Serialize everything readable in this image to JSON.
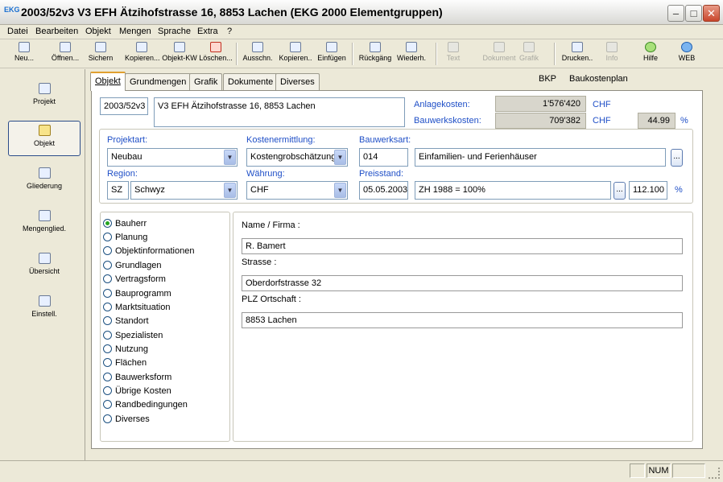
{
  "window": {
    "title": "2003/52v3 V3 EFH Ätzihofstrasse 16, 8853 Lachen (EKG 2000 Elementgruppen)",
    "icon_text": "EKG",
    "min": "‒",
    "max": "□",
    "close": "✕"
  },
  "menu": [
    "Datei",
    "Bearbeiten",
    "Objekt",
    "Mengen",
    "Sprache",
    "Extra",
    "?"
  ],
  "toolbar": {
    "neu": "Neu...",
    "oeffnen": "Öffnen...",
    "sichern": "Sichern",
    "kopieren1": "Kopieren...",
    "objekt_kw": "Objekt-KW",
    "loeschen": "Löschen...",
    "ausschn": "Ausschn.",
    "kopieren2": "Kopieren..",
    "einfuegen": "Einfügen",
    "rueckgaeng": "Rückgäng",
    "wiederh": "Wiederh.",
    "text": "Text",
    "dokument": "Dokument",
    "grafik": "Grafik",
    "drucken": "Drucken..",
    "info": "Info",
    "hilfe": "Hilfe",
    "web": "WEB"
  },
  "sidebar": [
    "Projekt",
    "Objekt",
    "Gliederung",
    "Mengenglied.",
    "Übersicht",
    "Einstell."
  ],
  "tabs": {
    "objekt": "Objekt",
    "grundmengen": "Grundmengen",
    "grafik": "Grafik",
    "dokumente": "Dokumente",
    "diverses": "Diverses"
  },
  "header": {
    "bkp": "BKP",
    "bkp_desc": "Baukostenplan"
  },
  "object": {
    "nr": "2003/52v3",
    "name": "V3 EFH Ätzihofstrasse 16, 8853 Lachen"
  },
  "costs": {
    "anlage_label": "Anlagekosten:",
    "anlage_value": "1'576'420",
    "anlage_cur": "CHF",
    "bauwerk_label": "Bauwerkskosten:",
    "bauwerk_value": "709'382",
    "bauwerk_cur": "CHF",
    "percent_value": "44.99",
    "percent_sign": "%"
  },
  "form": {
    "projektart_label": "Projektart:",
    "projektart": "Neubau",
    "kostenermittlung_label": "Kostenermittlung:",
    "kostenermittlung": "Kostengrobschätzung",
    "bauwerksart_label": "Bauwerksart:",
    "bauwerksart_code": "014",
    "bauwerksart_text": "Einfamilien- und Ferienhäuser",
    "region_label": "Region:",
    "region_code": "SZ",
    "region": "Schwyz",
    "waehrung_label": "Währung:",
    "waehrung": "CHF",
    "preisstand_label": "Preisstand:",
    "preisstand_date": "05.05.2003",
    "preisstand_index": "ZH 1988 = 100%",
    "preisstand_value": "112.100",
    "preisstand_pct": "%",
    "ellipsis": "..."
  },
  "radios": [
    "Bauherr",
    "Planung",
    "Objektinformationen",
    "Grundlagen",
    "Vertragsform",
    "Bauprogramm",
    "Marktsituation",
    "Standort",
    "Spezialisten",
    "Nutzung",
    "Flächen",
    "Bauwerksform",
    "Übrige Kosten",
    "Randbedingungen",
    "Diverses"
  ],
  "details": {
    "name_label": "Name / Firma :",
    "name": "R. Bamert",
    "strasse_label": "Strasse :",
    "strasse": "Oberdorfstrasse 32",
    "plz_label": "PLZ Ortschaft :",
    "plz": "8853 Lachen"
  },
  "status": {
    "num": "NUM"
  }
}
